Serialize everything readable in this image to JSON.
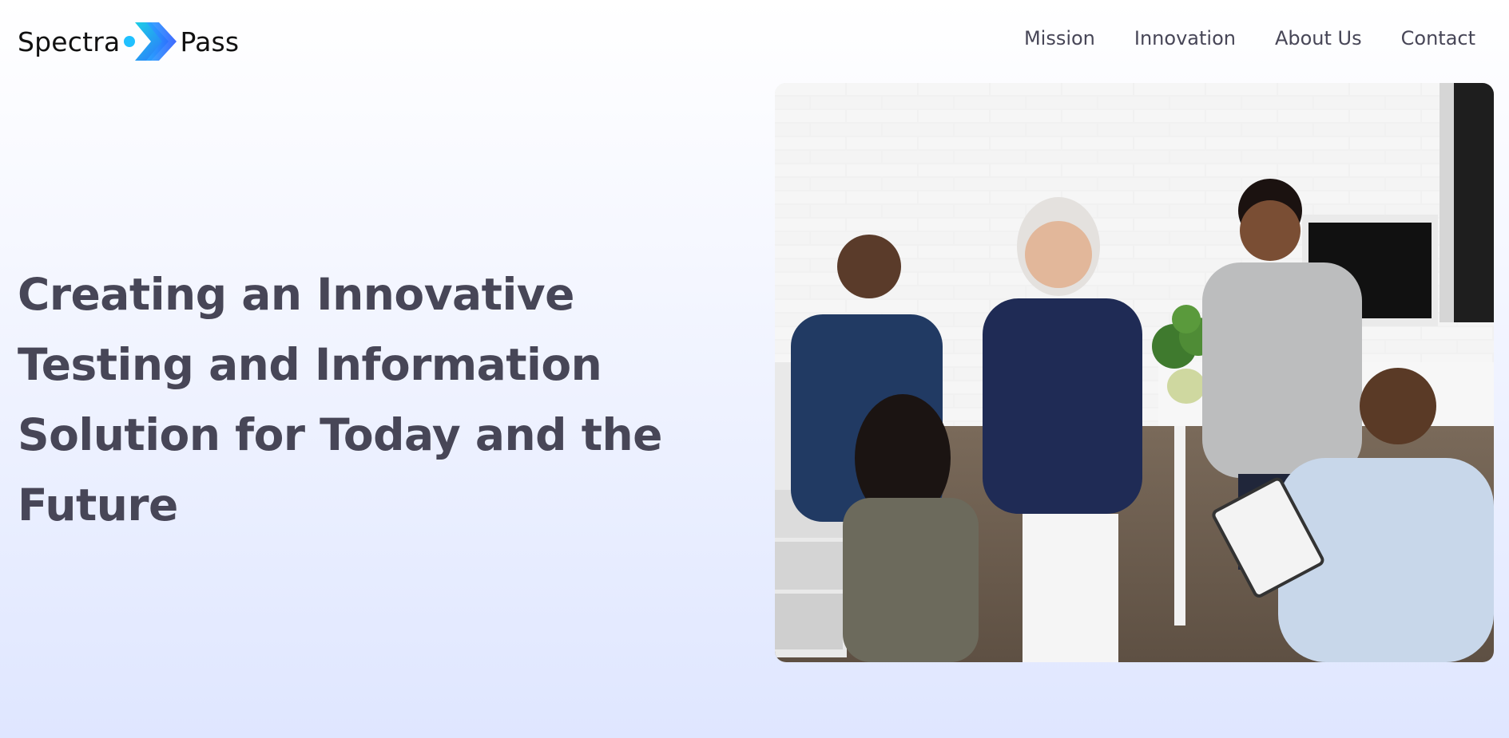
{
  "brand": {
    "left_word": "Spectra",
    "right_word": "Pass",
    "mark_icon": "chevron-arrow-logo-icon",
    "mark_colors": [
      "#2aa8ff",
      "#2f6bff",
      "#1ccfe6"
    ]
  },
  "nav": {
    "items": [
      {
        "label": "Mission"
      },
      {
        "label": "Innovation"
      },
      {
        "label": "About Us"
      },
      {
        "label": "Contact"
      }
    ]
  },
  "hero": {
    "title": "Creating an Innovative Testing and Information Solution for Today and the Future",
    "image_alt": ""
  },
  "colors": {
    "text": "#474657",
    "background_top": "#ffffff",
    "background_bottom": "#dfe6ff"
  }
}
